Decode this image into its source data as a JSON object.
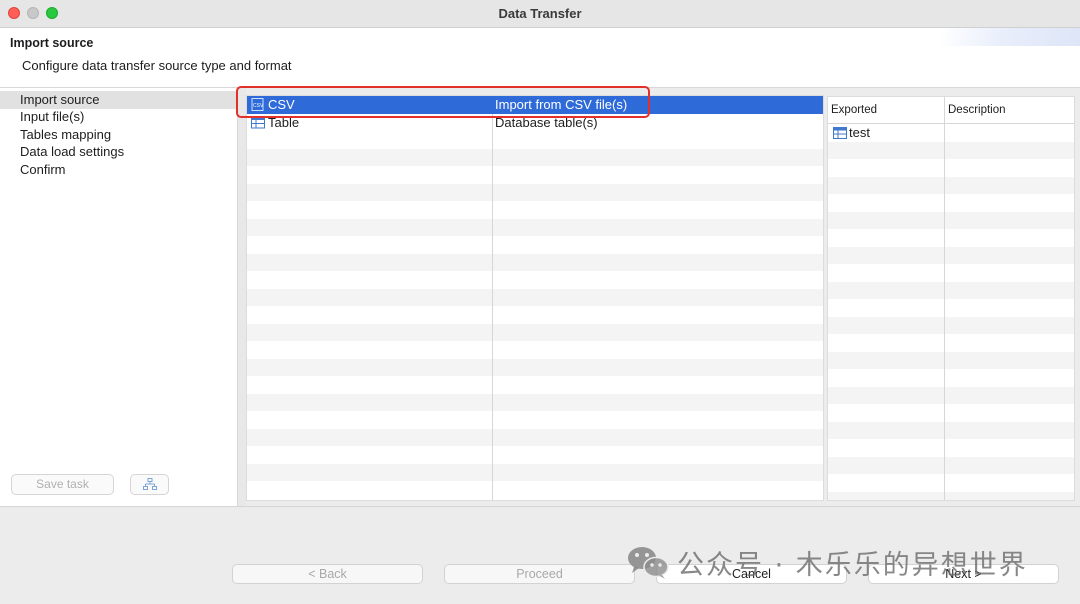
{
  "window": {
    "title": "Data Transfer"
  },
  "header": {
    "title": "Import source",
    "description": "Configure data transfer source type and format"
  },
  "nav": {
    "items": [
      {
        "label": "Import source",
        "active": true
      },
      {
        "label": "Input file(s)"
      },
      {
        "label": "Tables mapping"
      },
      {
        "label": "Data load settings"
      },
      {
        "label": "Confirm"
      }
    ],
    "save_task_label": "Save task",
    "task_icon": "hierarchy-icon"
  },
  "source_types": {
    "rows": [
      {
        "name": "CSV",
        "description": "Import from CSV file(s)",
        "icon": "csv-file-icon",
        "selected": true
      },
      {
        "name": "Table",
        "description": "Database table(s)",
        "icon": "table-icon"
      }
    ]
  },
  "exported": {
    "columns": [
      "Exported",
      "Description"
    ],
    "rows": [
      {
        "name": "test",
        "icon": "table-icon"
      }
    ]
  },
  "footer": {
    "back_label": "< Back",
    "proceed_label": "Proceed",
    "cancel_label": "Cancel",
    "next_label": "Next >"
  },
  "watermark": {
    "text": "公众号 · 木乐乐的异想世界"
  },
  "colors": {
    "selection": "#2f6ad9",
    "highlight_box": "#e2312a"
  }
}
